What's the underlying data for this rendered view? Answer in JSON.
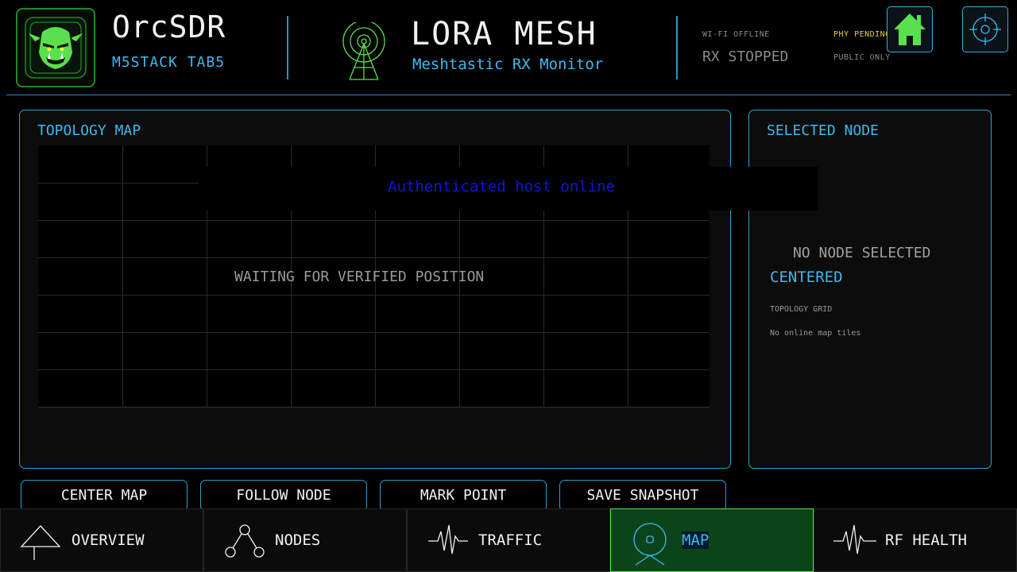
{
  "header": {
    "app_title": "OrcSDR",
    "app_subtitle": "M5STACK TAB5",
    "module_title": "LORA MESH",
    "module_subtitle": "Meshtastic RX Monitor",
    "status": {
      "wifi": "WI-FI OFFLINE",
      "rx": "RX STOPPED",
      "phy": "PHY PENDING",
      "access": "PUBLIC ONLY"
    },
    "home_icon": "home-icon",
    "target_icon": "crosshair-icon"
  },
  "map_panel": {
    "title": "TOPOLOGY MAP",
    "waiting_text": "WAITING FOR VERIFIED POSITION",
    "toast": "Authenticated host online"
  },
  "node_panel": {
    "title": "SELECTED NODE",
    "empty_text": "NO NODE SELECTED",
    "mode": "CENTERED",
    "map_type": "TOPOLOGY GRID",
    "tiles_note": "No online map tiles"
  },
  "actions": [
    {
      "label": "CENTER MAP"
    },
    {
      "label": "FOLLOW NODE"
    },
    {
      "label": "MARK POINT"
    },
    {
      "label": "SAVE SNAPSHOT"
    }
  ],
  "nav": [
    {
      "label": "OVERVIEW",
      "icon": "overview-icon"
    },
    {
      "label": "NODES",
      "icon": "nodes-icon"
    },
    {
      "label": "TRAFFIC",
      "icon": "waveform-icon"
    },
    {
      "label": "MAP",
      "icon": "map-pin-icon",
      "active": true
    },
    {
      "label": "RF HEALTH",
      "icon": "waveform-icon"
    }
  ],
  "colors": {
    "accent": "#41b8ee",
    "border": "#2e9fd0",
    "orc_green": "#5ae04e",
    "active_tab": "#0b4418",
    "status_warn": "#e8d23a",
    "toast_text": "#1414d8"
  }
}
